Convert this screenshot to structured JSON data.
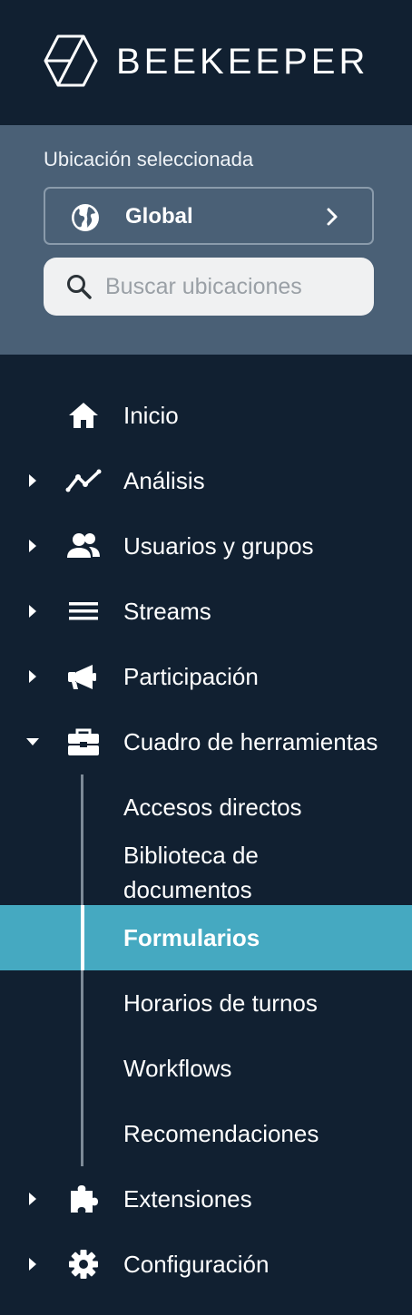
{
  "brand": {
    "name": "BEEKEEPER",
    "logo_icon": "hexagon-cube-icon"
  },
  "location": {
    "label": "Ubicación seleccionada",
    "selected": "Global",
    "selected_icon": "globe-icon",
    "search_placeholder": "Buscar ubicaciones"
  },
  "nav": {
    "items": [
      {
        "label": "Inicio",
        "icon": "home-icon",
        "expandable": false
      },
      {
        "label": "Análisis",
        "icon": "trend-line-icon",
        "expandable": true
      },
      {
        "label": "Usuarios y grupos",
        "icon": "users-icon",
        "expandable": true
      },
      {
        "label": "Streams",
        "icon": "menu-lines-icon",
        "expandable": true
      },
      {
        "label": "Participación",
        "icon": "megaphone-icon",
        "expandable": true
      },
      {
        "label": "Cuadro de herramientas",
        "icon": "toolbox-icon",
        "expandable": true,
        "expanded": true
      },
      {
        "label": "Extensiones",
        "icon": "puzzle-icon",
        "expandable": true
      },
      {
        "label": "Configuración",
        "icon": "gear-icon",
        "expandable": true
      }
    ],
    "toolbox_children": [
      {
        "label": "Accesos directos"
      },
      {
        "label": "Biblioteca de documentos"
      },
      {
        "label": "Formularios",
        "active": true
      },
      {
        "label": "Horarios de turnos"
      },
      {
        "label": "Workflows"
      },
      {
        "label": "Recomendaciones"
      }
    ]
  },
  "colors": {
    "sidebar_bg": "#112031",
    "location_panel_bg": "#4a6076",
    "active_item_bg": "#45a9c1",
    "text": "#ffffff"
  }
}
